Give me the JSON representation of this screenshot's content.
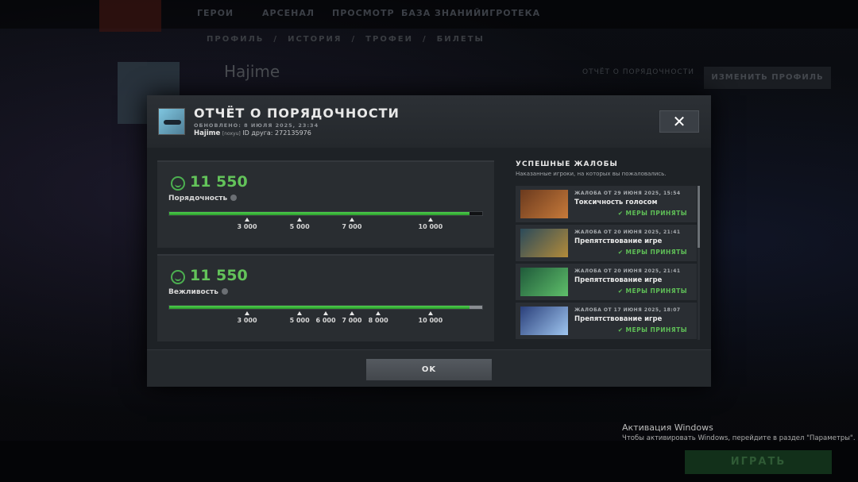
{
  "background": {
    "nav": [
      "ГЕРОИ",
      "АРСЕНАЛ",
      "ПРОСМОТР",
      "БАЗА ЗНАНИЙ",
      "ИГРОТЕКА"
    ],
    "subnav": [
      "ПРОФИЛЬ",
      "ИСТОРИЯ",
      "ТРОФЕИ",
      "БИЛЕТЫ"
    ],
    "profile_name": "Hajime",
    "edit_profile": "ИЗМЕНИТЬ ПРОФИЛЬ",
    "score_label": "ОТЧЁТ О ПОРЯДОЧНОСТИ",
    "play": "ИГРАТЬ",
    "windows_title": "Активация Windows",
    "windows_text": "Чтобы активировать Windows, перейдите в раздел \"Параметры\"."
  },
  "modal": {
    "title": "ОТЧЁТ О ПОРЯДОЧНОСТИ",
    "updated": "ОБНОВЛЕНО: 8 ИЮЛЯ 2025, 23:34",
    "username": "Hajime",
    "usertag": "[noxyu]",
    "friend_id": "ID друга: 272135976",
    "close": "✕",
    "ok": "OK"
  },
  "scores": [
    {
      "value": "11 550",
      "label": "Порядочность",
      "fill": 0.96,
      "ticks": [
        {
          "label": "3 000",
          "pos": 0.25
        },
        {
          "label": "5 000",
          "pos": 0.417
        },
        {
          "label": "7 000",
          "pos": 0.583
        },
        {
          "label": "10 000",
          "pos": 0.833
        }
      ]
    },
    {
      "value": "11 550",
      "label": "Вежливость",
      "fill": 0.96,
      "ticks": [
        {
          "label": "3 000",
          "pos": 0.25
        },
        {
          "label": "5 000",
          "pos": 0.417
        },
        {
          "label": "6 000",
          "pos": 0.5
        },
        {
          "label": "7 000",
          "pos": 0.583
        },
        {
          "label": "8 000",
          "pos": 0.667
        },
        {
          "label": "10 000",
          "pos": 0.833
        }
      ]
    }
  ],
  "reports": {
    "title": "УСПЕШНЫЕ ЖАЛОБЫ",
    "subtitle": "Наказанные игроки, на которых вы пожаловались.",
    "items": [
      {
        "date": "ЖАЛОБА ОТ 29 ИЮНЯ 2025, 15:54",
        "reason": "Токсичность голосом",
        "status": "МЕРЫ ПРИНЯТЫ",
        "colors": [
          "#6b3a1e",
          "#c77a3a"
        ]
      },
      {
        "date": "ЖАЛОБА ОТ 20 ИЮНЯ 2025, 21:41",
        "reason": "Препятствование игре",
        "status": "МЕРЫ ПРИНЯТЫ",
        "colors": [
          "#2b4a5a",
          "#b38b3a"
        ]
      },
      {
        "date": "ЖАЛОБА ОТ 20 ИЮНЯ 2025, 21:41",
        "reason": "Препятствование игре",
        "status": "МЕРЫ ПРИНЯТЫ",
        "colors": [
          "#1f5a3a",
          "#5fbf6a"
        ]
      },
      {
        "date": "ЖАЛОБА ОТ 17 ИЮНЯ 2025, 18:07",
        "reason": "Препятствование игре",
        "status": "МЕРЫ ПРИНЯТЫ",
        "colors": [
          "#2a3f7a",
          "#9fc6f0"
        ]
      }
    ]
  }
}
